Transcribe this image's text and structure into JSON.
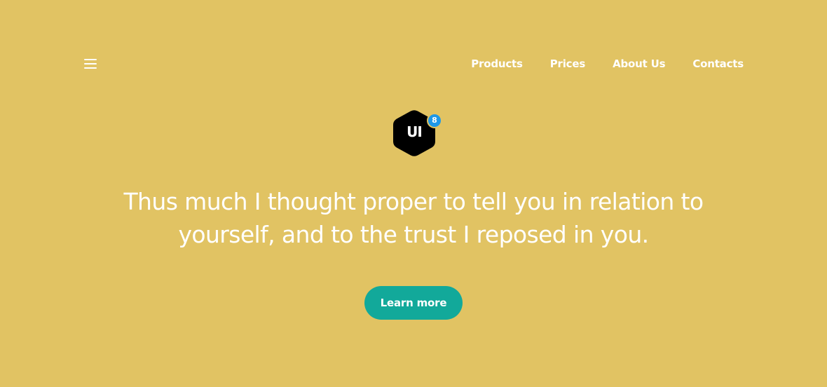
{
  "colors": {
    "background": "#E1C363",
    "text": "#FFFFFF",
    "button": "#12A99A",
    "logo_body": "#000000",
    "logo_badge": "#1E98E8"
  },
  "header": {
    "menu_icon": "hamburger-menu-icon",
    "nav_links": [
      {
        "label": "Products"
      },
      {
        "label": "Prices"
      },
      {
        "label": "About Us"
      },
      {
        "label": "Contacts"
      }
    ]
  },
  "logo": {
    "text": "UI",
    "badge": "8",
    "shape": "hexagon"
  },
  "hero": {
    "headline": "Thus much I thought proper to tell you in relation to yourself, and to the trust I reposed in you.",
    "cta_label": "Learn more"
  }
}
